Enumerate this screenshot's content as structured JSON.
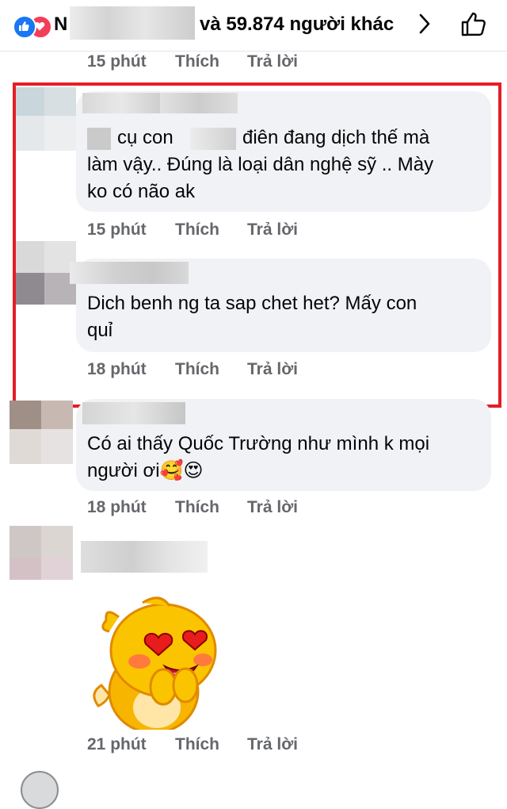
{
  "top_bar": {
    "name_initial": "N",
    "reactors_text": "và 59.874 người khác"
  },
  "comments": [
    {
      "time": "15 phút",
      "like": "Thích",
      "reply": "Trả lời"
    },
    {
      "text_part1": "cụ con",
      "text_part2": "điên đang dịch thế mà",
      "text_lines": [
        "làm vậy.. Đúng là loại dân nghệ sỹ .. Mày",
        "ko có não ak"
      ],
      "time": "15 phút",
      "like": "Thích",
      "reply": "Trả lời"
    },
    {
      "text_lines": [
        "Dich benh ng ta sap chet het? Mấy con",
        "quỉ"
      ],
      "time": "18 phút",
      "like": "Thích",
      "reply": "Trả lời"
    },
    {
      "text_lines": [
        "Có ai thấy Quốc Trường như mình k mọi",
        "người ơi"
      ],
      "emoji": [
        "🥰",
        "😍"
      ],
      "time": "18 phút",
      "like": "Thích",
      "reply": "Trả lời"
    },
    {
      "time": "21 phút",
      "like": "Thích",
      "reply": "Trả lời"
    }
  ],
  "colors": {
    "accent_blue": "#1877f2",
    "love_red": "#f33e58",
    "highlight_red": "#e41e26",
    "bubble_gray": "#f0f2f5",
    "meta_gray": "#65676b"
  }
}
